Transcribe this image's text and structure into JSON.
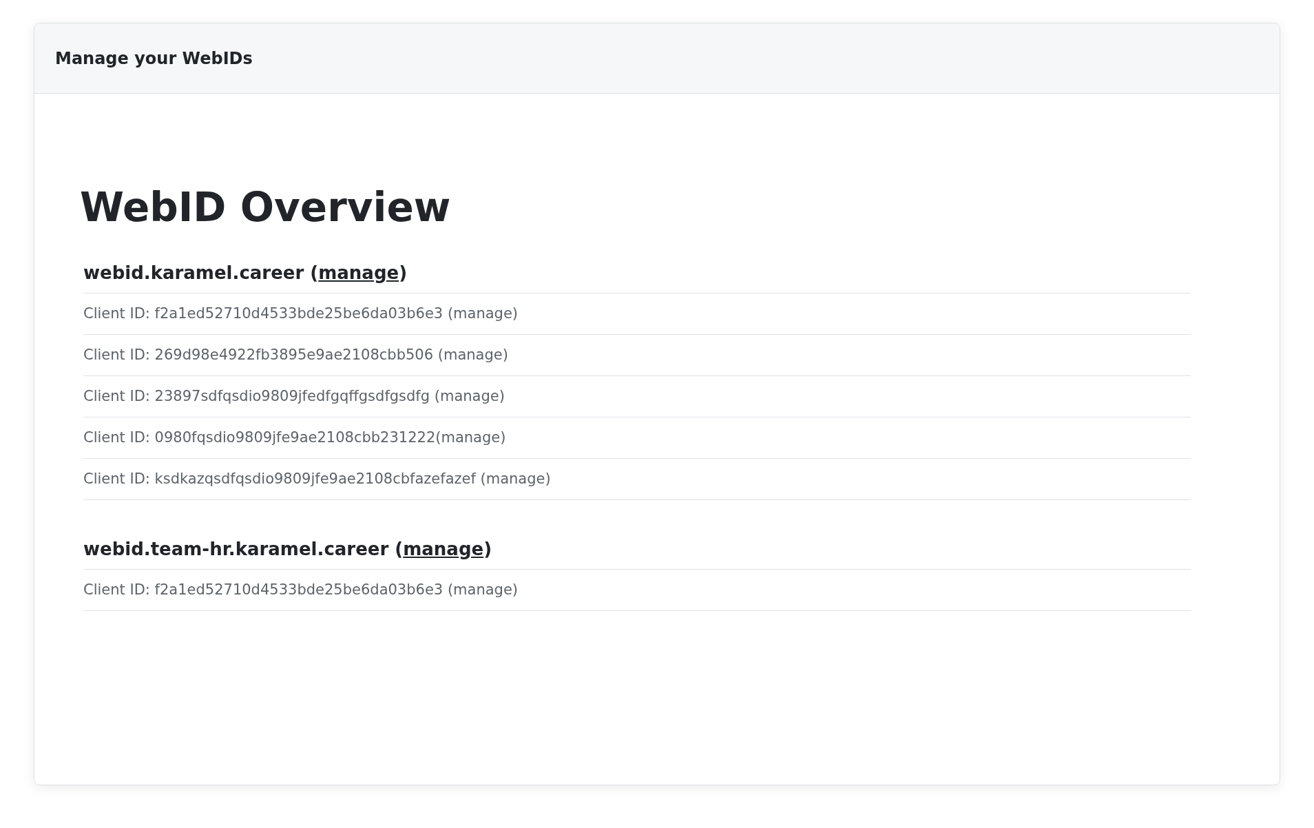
{
  "header": {
    "title": "Manage your WebIDs"
  },
  "page": {
    "title": "WebID Overview"
  },
  "webids": [
    {
      "name": "webid.karamel.career (",
      "link": "manage",
      "suffix": ")",
      "clients": [
        "Client ID: f2a1ed52710d4533bde25be6da03b6e3 (manage)",
        "Client ID: 269d98e4922fb3895e9ae2108cbb506 (manage)",
        "Client ID: 23897sdfqsdio9809jfedfgqffgsdfgsdfg (manage)",
        "Client ID: 0980fqsdio9809jfe9ae2108cbb231222(manage)",
        "Client ID: ksdkazqsdfqsdio9809jfe9ae2108cbfazefazef (manage)"
      ]
    },
    {
      "name": "webid.team-hr.karamel.career (",
      "link": "manage",
      "suffix": ")",
      "clients": [
        "Client ID: f2a1ed52710d4533bde25be6da03b6e3 (manage)"
      ]
    }
  ]
}
